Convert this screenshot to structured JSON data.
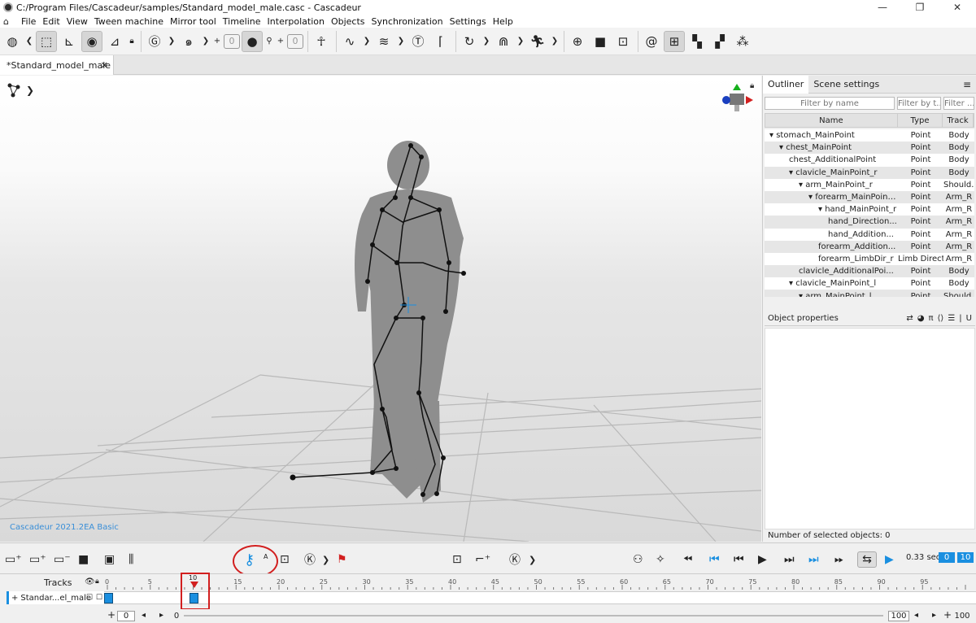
{
  "window": {
    "title": "C:/Program Files/Cascadeur/samples/Standard_model_male.casc - Cascadeur",
    "controls": [
      "—",
      "❐",
      "✕"
    ]
  },
  "menu": [
    "File",
    "Edit",
    "View",
    "Tween machine",
    "Mirror tool",
    "Timeline",
    "Interpolation",
    "Objects",
    "Synchronization",
    "Settings",
    "Help"
  ],
  "toolbar": {
    "stepper_a": "0",
    "stepper_b": "0",
    "plus": "+",
    "minus": "−"
  },
  "tabs": {
    "active": "*Standard_model_male",
    "close": "✕"
  },
  "viewport": {
    "version_text": "Cascadeur 2021.2EA Basic"
  },
  "right_panel": {
    "tabs": [
      "Outliner",
      "Scene settings"
    ],
    "filters": {
      "name_placeholder": "Filter by name",
      "type_placeholder": "Filter by t...",
      "track_placeholder": "Filter ..."
    },
    "columns": [
      "Name",
      "Type",
      "Track"
    ],
    "rows": [
      {
        "name": "▾ stomach_MainPoint",
        "type": "Point",
        "track": "Body",
        "indent": 0
      },
      {
        "name": "▾ chest_MainPoint",
        "type": "Point",
        "track": "Body",
        "indent": 1
      },
      {
        "name": "chest_AdditionalPoint",
        "type": "Point",
        "track": "Body",
        "indent": 2
      },
      {
        "name": "▾ clavicle_MainPoint_r",
        "type": "Point",
        "track": "Body",
        "indent": 2
      },
      {
        "name": "▾ arm_MainPoint_r",
        "type": "Point",
        "track": "Should...",
        "indent": 3
      },
      {
        "name": "▾ forearm_MainPoint_r",
        "type": "Point",
        "track": "Arm_R",
        "indent": 4
      },
      {
        "name": "▾ hand_MainPoint_r",
        "type": "Point",
        "track": "Arm_R",
        "indent": 5
      },
      {
        "name": "hand_Direction...",
        "type": "Point",
        "track": "Arm_R",
        "indent": 6
      },
      {
        "name": "hand_Addition...",
        "type": "Point",
        "track": "Arm_R",
        "indent": 6
      },
      {
        "name": "forearm_Addition...",
        "type": "Point",
        "track": "Arm_R",
        "indent": 5
      },
      {
        "name": "forearm_LimbDir_r",
        "type": "Limb Direct...",
        "track": "Arm_R",
        "indent": 5
      },
      {
        "name": "clavicle_AdditionalPoi...",
        "type": "Point",
        "track": "Body",
        "indent": 3
      },
      {
        "name": "▾ clavicle_MainPoint_l",
        "type": "Point",
        "track": "Body",
        "indent": 2
      },
      {
        "name": "▾ arm_MainPoint_l",
        "type": "Point",
        "track": "Should...",
        "indent": 3
      }
    ],
    "object_properties": "Object properties",
    "selected_count": "Number of selected objects: 0"
  },
  "playback": {
    "time": "0.33 sec",
    "frame_start": "0",
    "frame_end": "10"
  },
  "timeline": {
    "tracks_label": "Tracks",
    "track_name": "Standar...el_male",
    "current_frame": "10",
    "ticks": [
      "0",
      "5",
      "10",
      "15",
      "20",
      "25",
      "30",
      "35",
      "40",
      "45",
      "50",
      "55",
      "60",
      "65",
      "70",
      "75",
      "80",
      "85",
      "90",
      "95"
    ],
    "range_start": "0",
    "range_start2": "0",
    "range_end": "100",
    "range_end2": "100"
  }
}
